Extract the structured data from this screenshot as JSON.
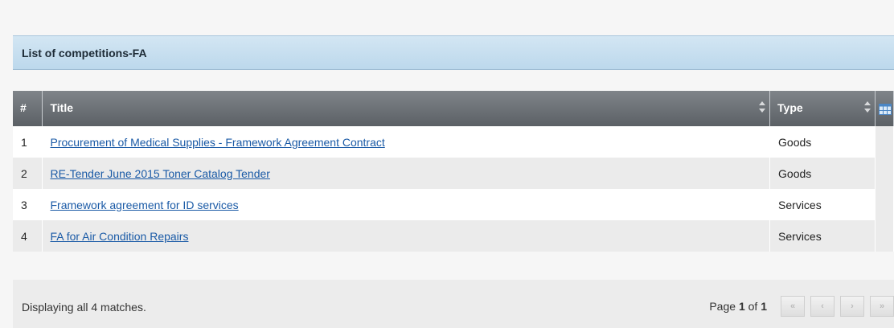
{
  "panel": {
    "title": "List of competitions-FA"
  },
  "grid": {
    "columns": {
      "num": "#",
      "title": "Title",
      "type": "Type"
    },
    "rows": [
      {
        "num": "1",
        "title": "Procurement of Medical Supplies - Framework Agreement Contract",
        "type": "Goods"
      },
      {
        "num": "2",
        "title": "RE-Tender June 2015 Toner Catalog Tender",
        "type": "Goods"
      },
      {
        "num": "3",
        "title": "Framework agreement for ID services",
        "type": "Services"
      },
      {
        "num": "4",
        "title": "FA for Air Condition Repairs",
        "type": "Services"
      }
    ]
  },
  "footer": {
    "status": "Displaying all 4 matches.",
    "page_prefix": "Page ",
    "page_current": "1",
    "page_of": " of ",
    "page_total": "1",
    "buttons": {
      "first": "«",
      "prev": "‹",
      "next": "›",
      "last": "»"
    }
  },
  "icons": {
    "sort": "sort-arrows-icon",
    "column_chooser": "column-chooser-icon"
  },
  "colors": {
    "header_blue": "#c7dff0",
    "grid_header": "#6b7075",
    "link": "#1a5aa6"
  }
}
